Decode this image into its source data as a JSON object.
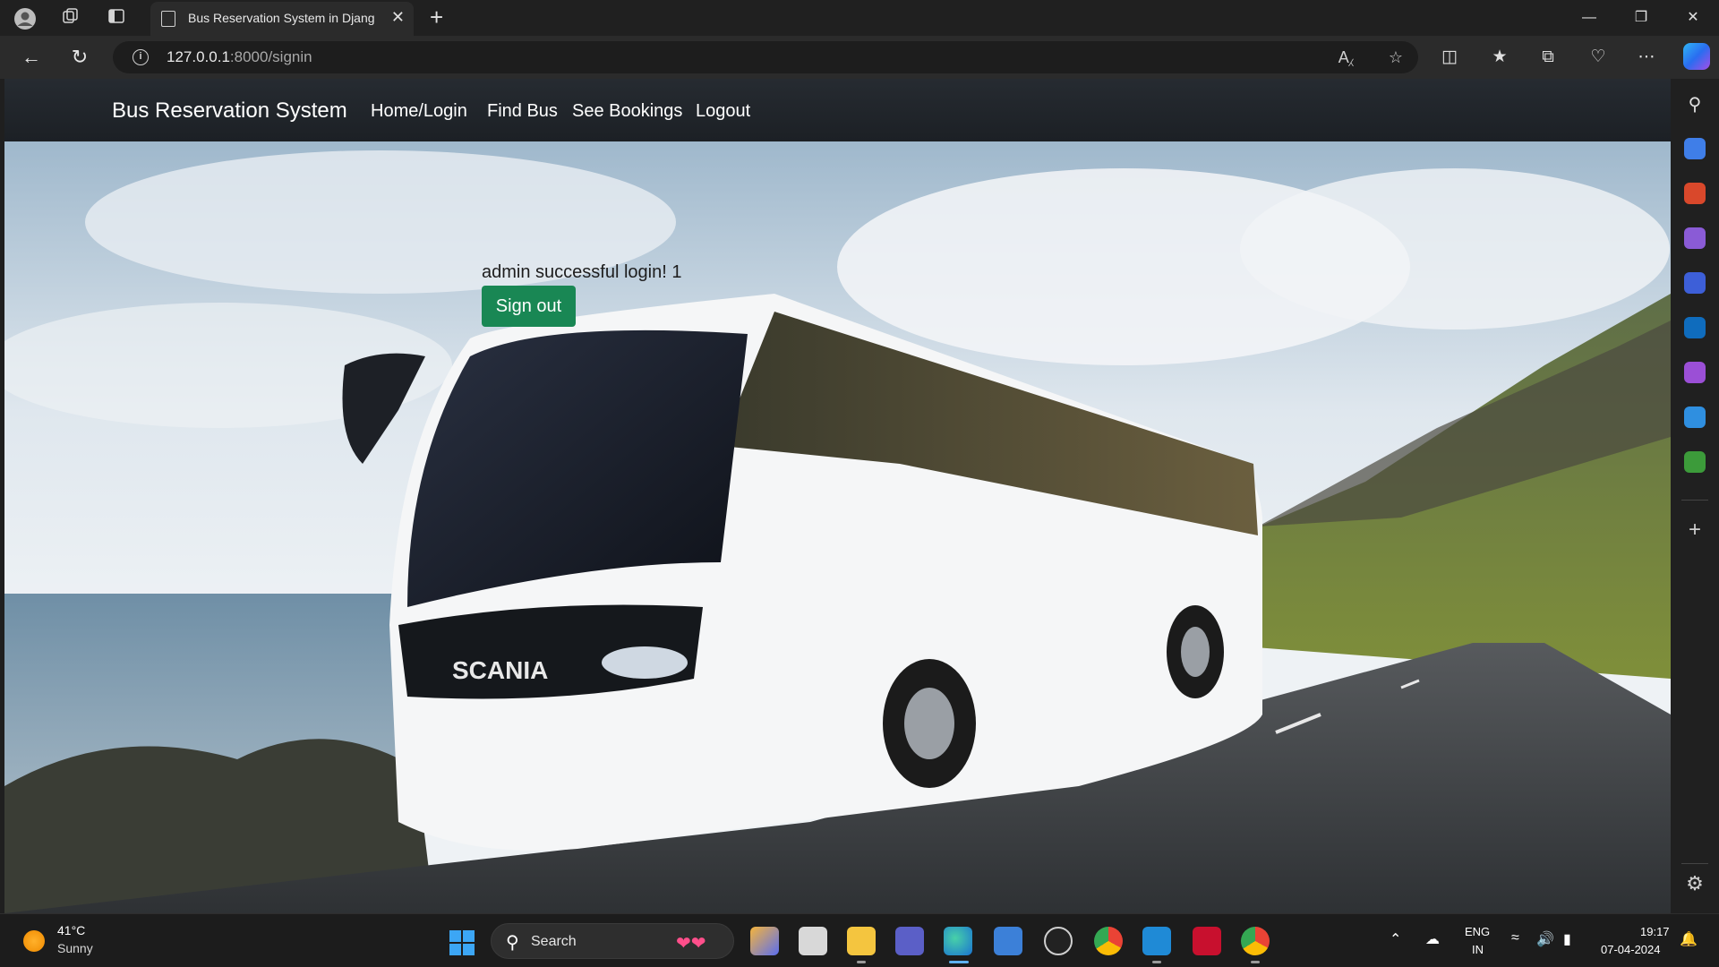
{
  "browser": {
    "tab_title": "Bus Reservation System in Djang",
    "url_host": "127.0.0.1",
    "url_path": ":8000/signin",
    "new_tab": "+",
    "close": "✕"
  },
  "page": {
    "brand": "Bus Reservation System",
    "nav": [
      "Home/Login",
      "Find Bus",
      "See Bookings",
      "Logout"
    ],
    "message": "admin successful login! 1",
    "signout_label": "Sign out",
    "bus_brand_text": "SCANIA"
  },
  "taskbar": {
    "temp": "41°C",
    "condition": "Sunny",
    "search_label": "Search",
    "lang_line1": "ENG",
    "lang_line2": "IN",
    "time": "19:17",
    "date": "07-04-2024"
  },
  "colors": {
    "navbar": "#212529",
    "signout": "#198754"
  }
}
